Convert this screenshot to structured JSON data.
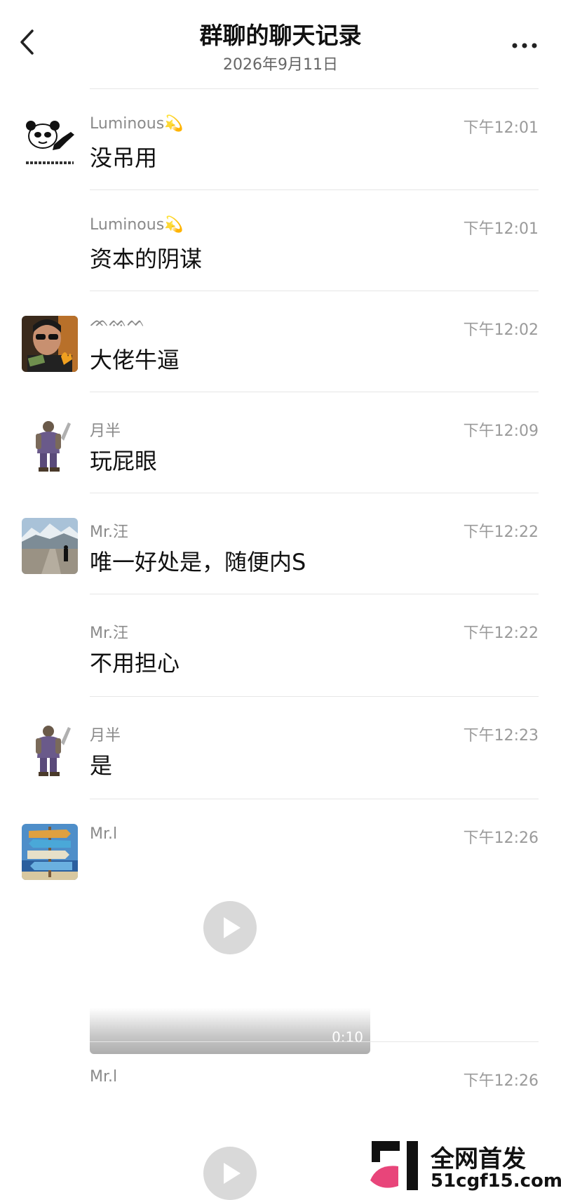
{
  "header": {
    "title": "群聊的聊天记录",
    "date": "2026年9月11日"
  },
  "messages": [
    {
      "name": "Luminous💫",
      "time": "下午12:01",
      "text": "没吊用",
      "avatar": "panda-meme-avatar"
    },
    {
      "name": "Luminous💫",
      "time": "下午12:01",
      "text": "资本的阴谋"
    },
    {
      "name": "ᨏᨐᨓ",
      "time": "下午12:02",
      "text": "大佬牛逼",
      "avatar": "sunglasses-man-avatar"
    },
    {
      "name": "月半",
      "time": "下午12:09",
      "text": "玩屁眼",
      "avatar": "warrior-avatar"
    },
    {
      "name": "Mr.汪",
      "time": "下午12:22",
      "text": "唯一好处是，随便内S",
      "avatar": "mountain-road-avatar"
    },
    {
      "name": "Mr.汪",
      "time": "下午12:22",
      "text": "不用担心"
    },
    {
      "name": "月半",
      "time": "下午12:23",
      "text": "是",
      "avatar": "warrior-avatar"
    },
    {
      "name": "Mr.l",
      "time": "下午12:26",
      "video_duration": "0:10",
      "avatar": "beach-signpost-avatar"
    },
    {
      "name": "Mr.l",
      "time": "下午12:26"
    }
  ],
  "watermark": {
    "line1": "全网首发",
    "line2": "51cgf15.com"
  },
  "colors": {
    "background": "#ffffff",
    "divider": "#e6e6e6",
    "name_gray": "#8a8a8a",
    "time_gray": "#9a9a9a",
    "play_button": "#d9d9d9",
    "watermark_pink": "#e8457a"
  }
}
